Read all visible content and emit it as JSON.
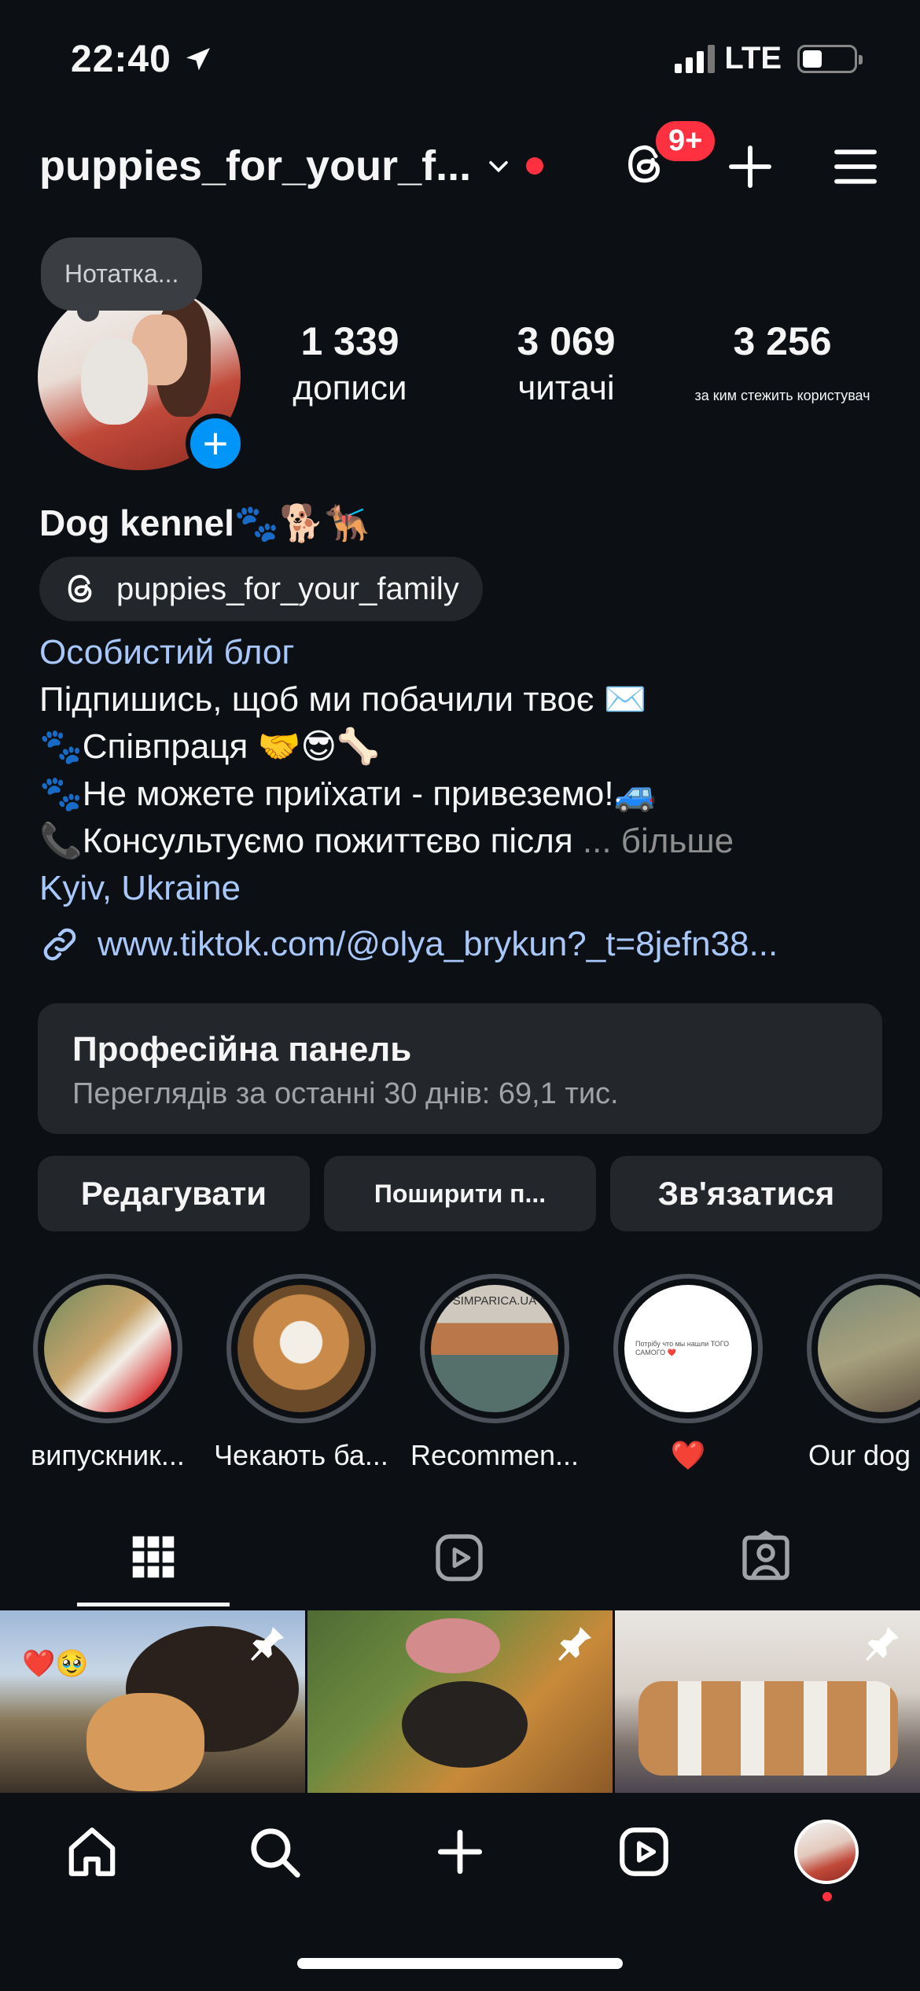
{
  "status_bar": {
    "time": "22:40",
    "network": "LTE"
  },
  "header": {
    "username": "puppies_for_your_f...",
    "threads_badge": "9+"
  },
  "profile": {
    "note": "Нотатка...",
    "stats": [
      {
        "value": "1 339",
        "label": "дописи"
      },
      {
        "value": "3 069",
        "label": "читачі"
      },
      {
        "value": "3 256",
        "label": "за ким стежить користувач"
      }
    ],
    "name": "Dog kennel🐾🐕🐕‍🦺",
    "threads_handle": "puppies_for_your_family",
    "category": "Особистий блог",
    "bio_lines": [
      "Підпишись, щоб ми побачили твоє ✉️",
      "🐾Співпраця 🤝😎🦴",
      "🐾Не можете приїхати - привеземо!🚙",
      "📞Консультуємо пожиттєво після"
    ],
    "bio_more": "... більше",
    "location": "Kyiv, Ukraine",
    "link": "www.tiktok.com/@olya_brykun?_t=8jefn38..."
  },
  "dashboard": {
    "title": "Професійна панель",
    "subtitle": "Переглядів за останні 30 днів: 69,1 тис."
  },
  "actions": {
    "edit": "Редагувати",
    "share": "Поширити п...",
    "contact": "Зв'язатися"
  },
  "highlights": [
    {
      "label": "випускник..."
    },
    {
      "label": "Чекають ба..."
    },
    {
      "label": "Recommen..."
    },
    {
      "label": "❤️"
    },
    {
      "label": "Our dog"
    }
  ],
  "highlight_texts": {
    "h3": "SIMPARICA.UA",
    "h4": "Потрібу что мы нашли ТОГО САМОГО ❤️"
  },
  "grid_posts": [
    {
      "caption": "❤️🥹"
    },
    {
      "caption": ""
    },
    {
      "caption": ""
    }
  ],
  "colors": {
    "background": "#0c1014",
    "accent_link": "#a8c7fa",
    "badge_red": "#ff3040",
    "blue": "#0095f6",
    "panel": "#23262b"
  }
}
